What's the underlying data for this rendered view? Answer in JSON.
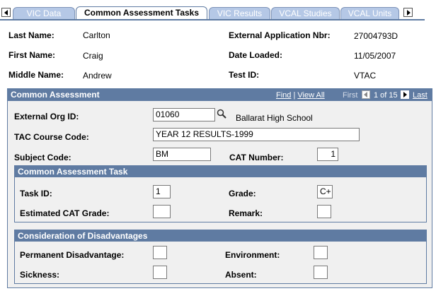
{
  "tabs": [
    {
      "label": "VIC Data",
      "active": false
    },
    {
      "label": "Common Assessment Tasks",
      "active": true
    },
    {
      "label": "VIC Results",
      "active": false
    },
    {
      "label": "VCAL Studies",
      "active": false
    },
    {
      "label": "VCAL Units",
      "active": false
    }
  ],
  "header": {
    "last_name_label": "Last Name:",
    "last_name": "Carlton",
    "first_name_label": "First Name:",
    "first_name": "Craig",
    "middle_name_label": "Middle Name:",
    "middle_name": "Andrew",
    "ext_app_label": "External Application Nbr:",
    "ext_app": "27004793D",
    "date_loaded_label": "Date Loaded:",
    "date_loaded": "11/05/2007",
    "test_id_label": "Test ID:",
    "test_id": "VTAC"
  },
  "common_assessment": {
    "title": "Common Assessment",
    "find": "Find",
    "sep": "|",
    "view_all": "View All",
    "first": "First",
    "range": "1 of 15",
    "last": "Last",
    "ext_org_label": "External Org ID:",
    "ext_org_value": "01060",
    "ext_org_name": "Ballarat High School",
    "tac_label": "TAC Course Code:",
    "tac_value": "YEAR 12 RESULTS-1999",
    "subject_label": "Subject Code:",
    "subject_value": "BM",
    "cat_number_label": "CAT Number:",
    "cat_number_value": "1"
  },
  "task": {
    "title": "Common Assessment Task",
    "task_id_label": "Task ID:",
    "task_id_value": "1",
    "grade_label": "Grade:",
    "grade_value": "C+",
    "est_cat_label": "Estimated CAT Grade:",
    "est_cat_value": "",
    "remark_label": "Remark:",
    "remark_value": ""
  },
  "disadvantages": {
    "title": "Consideration of Disadvantages",
    "permanent_label": "Permanent Disadvantage:",
    "permanent_value": "",
    "environment_label": "Environment:",
    "environment_value": "",
    "sickness_label": "Sickness:",
    "sickness_value": "",
    "absent_label": "Absent:",
    "absent_value": ""
  },
  "icons": {
    "tab_prev": "left-arrow-icon",
    "tab_next": "right-arrow-icon",
    "lookup": "magnifier-icon",
    "nav_prev": "left-arrow-icon",
    "nav_next": "right-arrow-icon"
  },
  "colors": {
    "panel_header": "#5f7ba2",
    "tab_inactive": "#b5c8e6",
    "panel_bg": "#f0f0f0"
  }
}
